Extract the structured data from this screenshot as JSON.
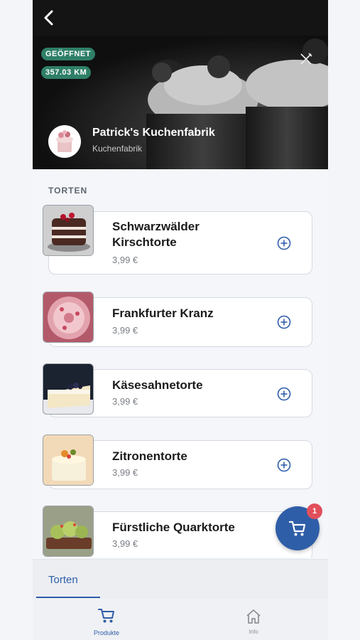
{
  "header": {
    "status_badge": "GEÖFFNET",
    "distance_badge": "357.03 KM",
    "shop_name": "Patrick's Kuchenfabrik",
    "shop_subtitle": "Kuchenfabrik"
  },
  "section_title": "TORTEN",
  "products": [
    {
      "name_lines": [
        "Schwarzwälder",
        "Kirschtorte"
      ],
      "price": "3,99 €"
    },
    {
      "name_lines": [
        "Frankfurter Kranz"
      ],
      "price": "3,99 €"
    },
    {
      "name_lines": [
        "Käsesahnetorte"
      ],
      "price": "3,99 €"
    },
    {
      "name_lines": [
        "Zitronentorte"
      ],
      "price": "3,99 €"
    },
    {
      "name_lines": [
        "Fürstliche Quarktorte"
      ],
      "price": "3,99 €"
    }
  ],
  "cart": {
    "count": "1"
  },
  "category_tabs": [
    {
      "label": "Torten",
      "active": true
    }
  ],
  "bottom_nav": [
    {
      "label": "Produkte",
      "icon": "cart-icon",
      "active": true
    },
    {
      "label": "Info",
      "icon": "home-icon",
      "active": false
    }
  ],
  "colors": {
    "accent": "#2f5ea8",
    "badge_green": "#2f7f68",
    "cart_badge": "#e14f5b"
  }
}
